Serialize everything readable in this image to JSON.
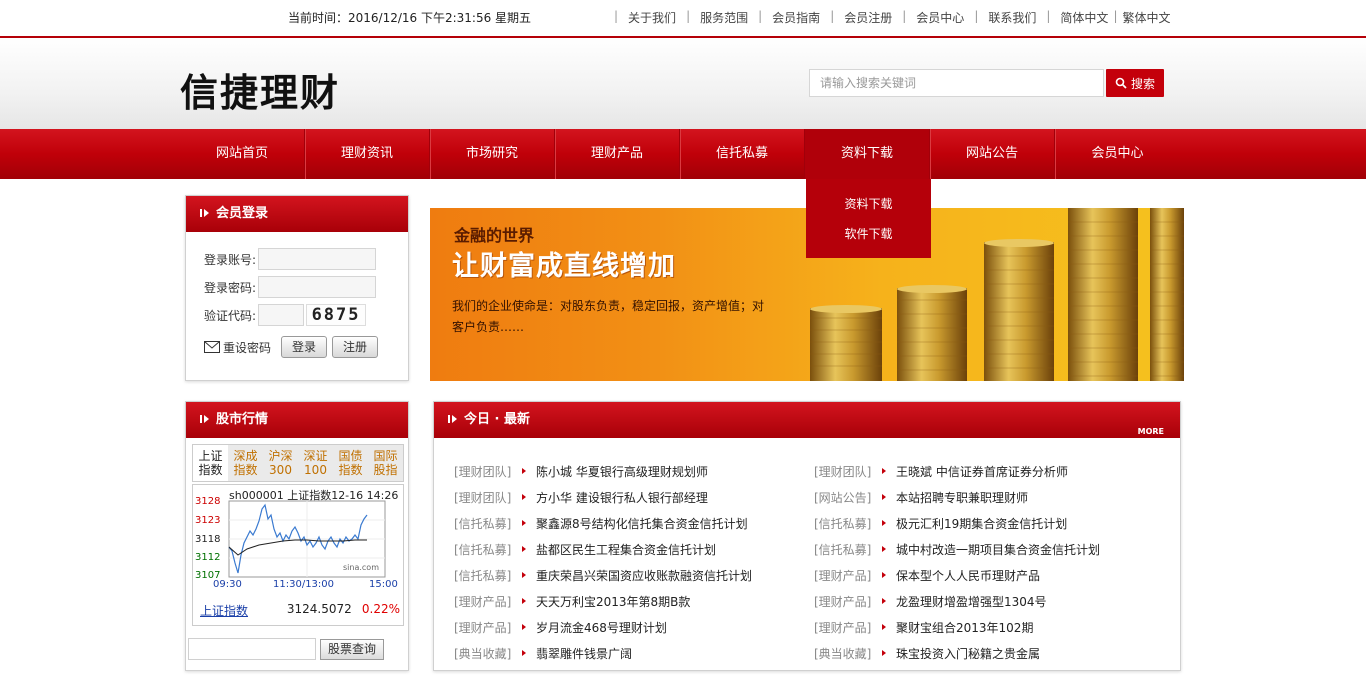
{
  "topbar": {
    "time": "当前时间：2016/12/16 下午2:31:56 星期五",
    "links": [
      "关于我们",
      "服务范围",
      "会员指南",
      "会员注册",
      "会员中心",
      "联系我们",
      "简体中文",
      "繁体中文"
    ]
  },
  "header": {
    "logo": "信捷理财",
    "search_placeholder": "请输入搜索关键词",
    "search_button": "搜索"
  },
  "nav": {
    "items": [
      "网站首页",
      "理财资讯",
      "市场研究",
      "理财产品",
      "信托私募",
      "资料下载",
      "网站公告",
      "会员中心"
    ],
    "active_index": 5,
    "dropdown": [
      "资料下载",
      "软件下载"
    ]
  },
  "login": {
    "title": "会员登录",
    "account_label": "登录账号:",
    "password_label": "登录密码:",
    "code_label": "验证代码:",
    "captcha": "6875",
    "reset_label": "重设密码",
    "login_button": "登录",
    "register_button": "注册"
  },
  "banner": {
    "line1": "金融的世界",
    "line2": "让财富成直线增加",
    "line3": "我们的企业使命是：对股东负责，稳定回报，资产增值；对客户负责……"
  },
  "stock": {
    "title": "股市行情",
    "tabs": [
      "上证指数",
      "深成指数",
      "沪深300",
      "深证100",
      "国债指数",
      "国际股指"
    ],
    "chart_label": "sh000001 上证指数12-16 14:26",
    "chart_source": "sina.com",
    "y_ticks": [
      "3128",
      "3123",
      "3118",
      "3112",
      "3107"
    ],
    "x_ticks": [
      "09:30",
      "11:30/13:00",
      "15:00"
    ],
    "quote_name": "上证指数",
    "quote_value": "3124.5072",
    "quote_change": "0.22%",
    "search_button": "股票查询"
  },
  "news": {
    "title": "今日 · 最新",
    "more": "MORE",
    "left": [
      {
        "cat": "[理财团队]",
        "title": "陈小城 华夏银行高级理财规划师"
      },
      {
        "cat": "[理财团队]",
        "title": "方小华 建设银行私人银行部经理"
      },
      {
        "cat": "[信托私募]",
        "title": "聚鑫源8号结构化信托集合资金信托计划"
      },
      {
        "cat": "[信托私募]",
        "title": "盐都区民生工程集合资金信托计划"
      },
      {
        "cat": "[信托私募]",
        "title": "重庆荣昌兴荣国资应收账款融资信托计划"
      },
      {
        "cat": "[理财产品]",
        "title": "天天万利宝2013年第8期B款"
      },
      {
        "cat": "[理财产品]",
        "title": "岁月流金468号理财计划"
      },
      {
        "cat": "[典当收藏]",
        "title": "翡翠雕件钱景广阔"
      }
    ],
    "right": [
      {
        "cat": "[理财团队]",
        "title": "王晓斌 中信证券首席证券分析师"
      },
      {
        "cat": "[网站公告]",
        "title": "本站招聘专职兼职理财师"
      },
      {
        "cat": "[信托私募]",
        "title": "极元汇利19期集合资金信托计划"
      },
      {
        "cat": "[信托私募]",
        "title": "城中村改造一期项目集合资金信托计划"
      },
      {
        "cat": "[理财产品]",
        "title": "保本型个人人民币理财产品"
      },
      {
        "cat": "[理财产品]",
        "title": "龙盈理财增盈增强型1304号"
      },
      {
        "cat": "[理财产品]",
        "title": "聚财宝组合2013年102期"
      },
      {
        "cat": "[典当收藏]",
        "title": "珠宝投资入门秘籍之贵金属"
      }
    ]
  },
  "colors": {
    "brand_red": "#c4000b",
    "banner_orange": "#f29015",
    "quote_up": "#e00000"
  }
}
